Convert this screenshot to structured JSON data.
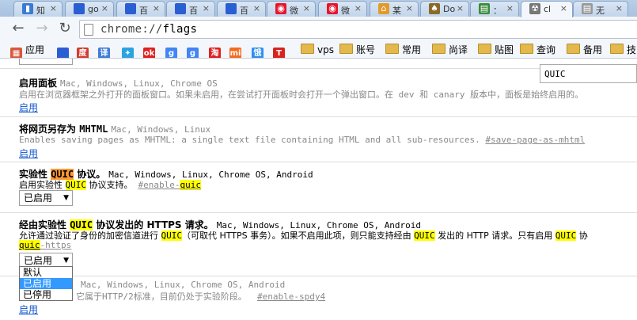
{
  "tabs": [
    {
      "label": "知",
      "icon": "bar-chart-icon",
      "color": "#3a7bd5"
    },
    {
      "label": "go",
      "icon": "paw-icon",
      "color": "#2f5bd6"
    },
    {
      "label": "百",
      "icon": "paw-icon",
      "color": "#2f5bd6"
    },
    {
      "label": "百",
      "icon": "paw-icon",
      "color": "#2f5bd6"
    },
    {
      "label": "百",
      "icon": "paw-icon",
      "color": "#2f5bd6"
    },
    {
      "label": "微",
      "icon": "weibo-icon",
      "color": "#e6162d"
    },
    {
      "label": "微",
      "icon": "weibo-icon",
      "color": "#e6162d"
    },
    {
      "label": "某",
      "icon": "home-icon",
      "color": "#e39a2b"
    },
    {
      "label": "Do",
      "icon": "acorn-icon",
      "color": "#8a6a2b"
    },
    {
      "label": "：",
      "icon": "page-icon",
      "color": "#3b8b3b"
    },
    {
      "label": "cl",
      "icon": "radiation-icon",
      "color": "#777777"
    },
    {
      "label": "无",
      "icon": "page-icon",
      "color": "#999999"
    }
  ],
  "toolbar": {
    "url_scheme": "chrome://",
    "url_path": "flags"
  },
  "bookmarks": [
    {
      "label": "应用",
      "icon": "apps-grid-icon",
      "color": "#d8583e"
    },
    {
      "label": "",
      "icon": "paw-icon",
      "color": "#2f5bd6"
    },
    {
      "label": "",
      "icon": "baidu-icon",
      "color": "#d23b2f"
    },
    {
      "label": "",
      "icon": "translate-icon",
      "color": "#3d7ed8"
    },
    {
      "label": "",
      "icon": "bird-icon",
      "color": "#2aa4e0"
    },
    {
      "label": "",
      "icon": "ok-icon",
      "color": "#e02020"
    },
    {
      "label": "",
      "icon": "google-icon",
      "color": "#4285f4"
    },
    {
      "label": "",
      "icon": "google-icon",
      "color": "#4285f4"
    },
    {
      "label": "",
      "icon": "taobao-icon",
      "color": "#e02020"
    },
    {
      "label": "",
      "icon": "mi-icon",
      "color": "#f46b20"
    },
    {
      "label": "",
      "icon": "ele-icon",
      "color": "#2c8ff0"
    },
    {
      "label": "",
      "icon": "toutiao-icon",
      "color": "#d7241e"
    },
    {
      "label": "",
      "icon": "netease-icon",
      "color": "#cc2a22"
    },
    {
      "label": "vps",
      "icon": "folder-icon",
      "color": "#e3b84d"
    },
    {
      "label": "账号",
      "icon": "folder-icon",
      "color": "#e3b84d"
    },
    {
      "label": "常用",
      "icon": "folder-icon",
      "color": "#e3b84d"
    },
    {
      "label": "尚译",
      "icon": "folder-icon",
      "color": "#e3b84d"
    },
    {
      "label": "贴图",
      "icon": "folder-icon",
      "color": "#e3b84d"
    },
    {
      "label": "查询",
      "icon": "folder-icon",
      "color": "#e3b84d"
    },
    {
      "label": "备用",
      "icon": "folder-icon",
      "color": "#e3b84d"
    },
    {
      "label": "技",
      "icon": "folder-icon",
      "color": "#e3b84d"
    }
  ],
  "findbar": {
    "query": "QUIC"
  },
  "experiments": {
    "panels": {
      "name": "启用面板",
      "platforms": "Mac, Windows, Linux, Chrome OS",
      "description": "启用在浏览器框架之外打开的面板窗口。如果未启用，在尝试打开面板时会打开一个弹出窗口。在 dev 和 canary 版本中，面板是始终启用的。",
      "action": "启用"
    },
    "mhtml": {
      "name_prefix": "将网页另存为 ",
      "name_code": "MHTML",
      "platforms": "Mac, Windows, Linux",
      "description": "Enables saving pages as MHTML: a single text file containing HTML and all sub-resources.",
      "hash": "#save-page-as-mhtml",
      "action": "启用"
    },
    "quic": {
      "name_prefix": "实验性 ",
      "name_hl": "QUIC",
      "name_suffix": " 协议。",
      "platforms": "Mac, Windows, Linux, Chrome OS, Android",
      "description_prefix": "启用实验性 ",
      "description_hl": "QUIC",
      "description_suffix": " 协议支持。",
      "hash_prefix": "#enable-",
      "hash_hl": "quic",
      "selected": "已启用"
    },
    "quic_https": {
      "name_prefix": "经由实验性 ",
      "name_hl": "QUIC",
      "name_suffix": " 协议发出的 HTTPS 请求。",
      "platforms": "Mac, Windows, Linux, Chrome OS, Android",
      "desc_part1": "允许通过验证了身份的加密信道进行 ",
      "desc_hl1": "QUIC",
      "desc_part2": "（可取代 HTTPS 事务）。如果不启用此项，则只能支持经由 ",
      "desc_hl2": "QUIC",
      "desc_part3": " 发出的 HTTP 请求。只有启用 ",
      "desc_hl3": "QUIC",
      "desc_part4": " 协",
      "hash_hl": "quic",
      "hash_suffix": "-https",
      "selected": "已启用",
      "options": [
        "默认",
        "已启用",
        "已停用"
      ],
      "highlighted_option": "已启用"
    },
    "spdy4": {
      "platforms": "Mac, Windows, Linux, Chrome OS, Android",
      "description": "它属于HTTP/2标准，目前仍处于实验阶段。",
      "hash": "#enable-spdy4",
      "action": "启用"
    }
  }
}
